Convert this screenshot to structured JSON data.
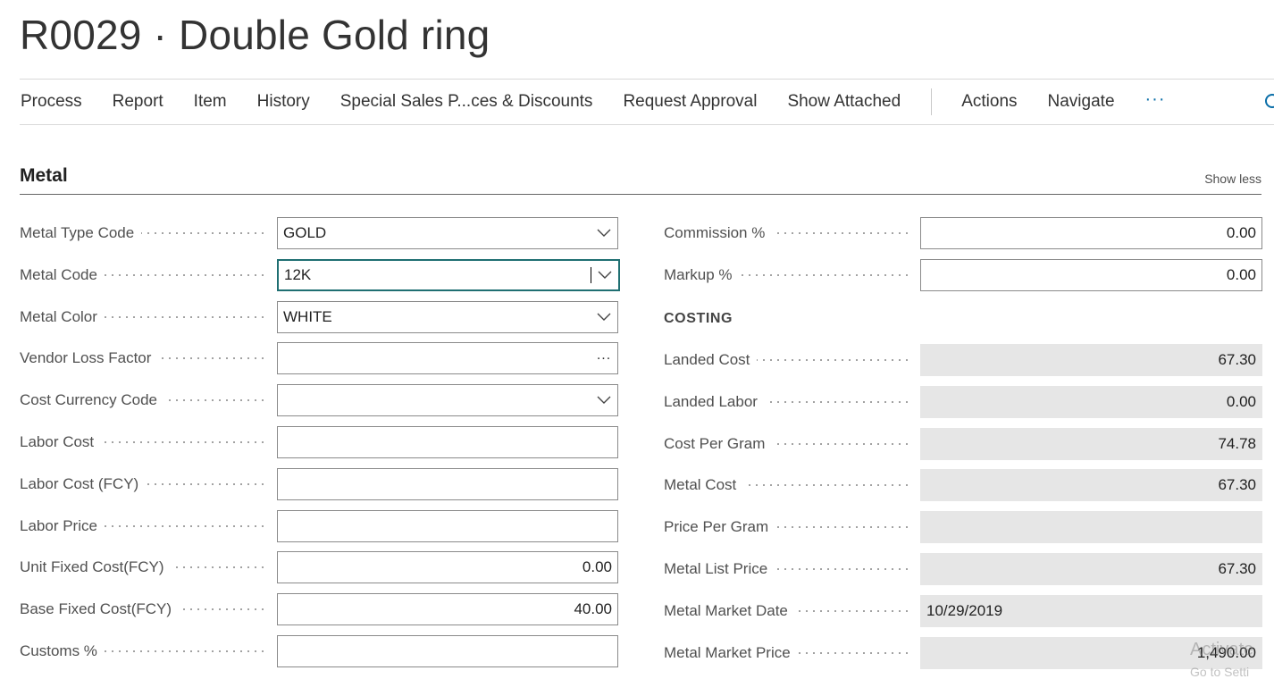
{
  "page": {
    "title": "R0029 · Double Gold ring"
  },
  "actions": [
    {
      "label": "Process"
    },
    {
      "label": "Report"
    },
    {
      "label": "Item"
    },
    {
      "label": "History"
    },
    {
      "label": "Special Sales P...ces & Discounts"
    },
    {
      "label": "Request Approval"
    },
    {
      "label": "Show Attached"
    },
    {
      "label": "Actions"
    },
    {
      "label": "Navigate"
    }
  ],
  "more_label": "···",
  "section": {
    "title": "Metal",
    "toggle_label": "Show less"
  },
  "left_fields": [
    {
      "label": "Metal Type Code",
      "value": "GOLD",
      "kind": "dropdown"
    },
    {
      "label": "Metal Code",
      "value": "12K",
      "kind": "dropdown",
      "focused": true
    },
    {
      "label": "Metal Color",
      "value": "WHITE",
      "kind": "dropdown"
    },
    {
      "label": "Vendor Loss Factor",
      "value": "",
      "kind": "lookup"
    },
    {
      "label": "Cost Currency Code",
      "value": "",
      "kind": "dropdown"
    },
    {
      "label": "Labor Cost",
      "value": "",
      "kind": "text"
    },
    {
      "label": "Labor Cost (FCY)",
      "value": "",
      "kind": "text"
    },
    {
      "label": "Labor Price",
      "value": "",
      "kind": "text"
    },
    {
      "label": "Unit Fixed Cost(FCY)",
      "value": "0.00",
      "kind": "number"
    },
    {
      "label": "Base Fixed Cost(FCY)",
      "value": "40.00",
      "kind": "number"
    },
    {
      "label": "Customs %",
      "value": "",
      "kind": "text"
    }
  ],
  "right_fields": [
    {
      "label": "Commission %",
      "value": "0.00",
      "kind": "number"
    },
    {
      "label": "Markup %",
      "value": "0.00",
      "kind": "number"
    }
  ],
  "costing": {
    "heading": "COSTING",
    "fields": [
      {
        "label": "Landed Cost",
        "value": "67.30",
        "align": "right"
      },
      {
        "label": "Landed Labor",
        "value": "0.00",
        "align": "right"
      },
      {
        "label": "Cost Per Gram",
        "value": "74.78",
        "align": "right"
      },
      {
        "label": "Metal Cost",
        "value": "67.30",
        "align": "right"
      },
      {
        "label": "Price Per Gram",
        "value": "",
        "align": "right"
      },
      {
        "label": "Metal List Price",
        "value": "67.30",
        "align": "right"
      },
      {
        "label": "Metal Market Date",
        "value": "10/29/2019",
        "align": "left"
      },
      {
        "label": "Metal Market Price",
        "value": "1,490.00",
        "align": "right"
      }
    ]
  },
  "watermark": {
    "line1": "Activate",
    "line2": "Go to Setti"
  }
}
